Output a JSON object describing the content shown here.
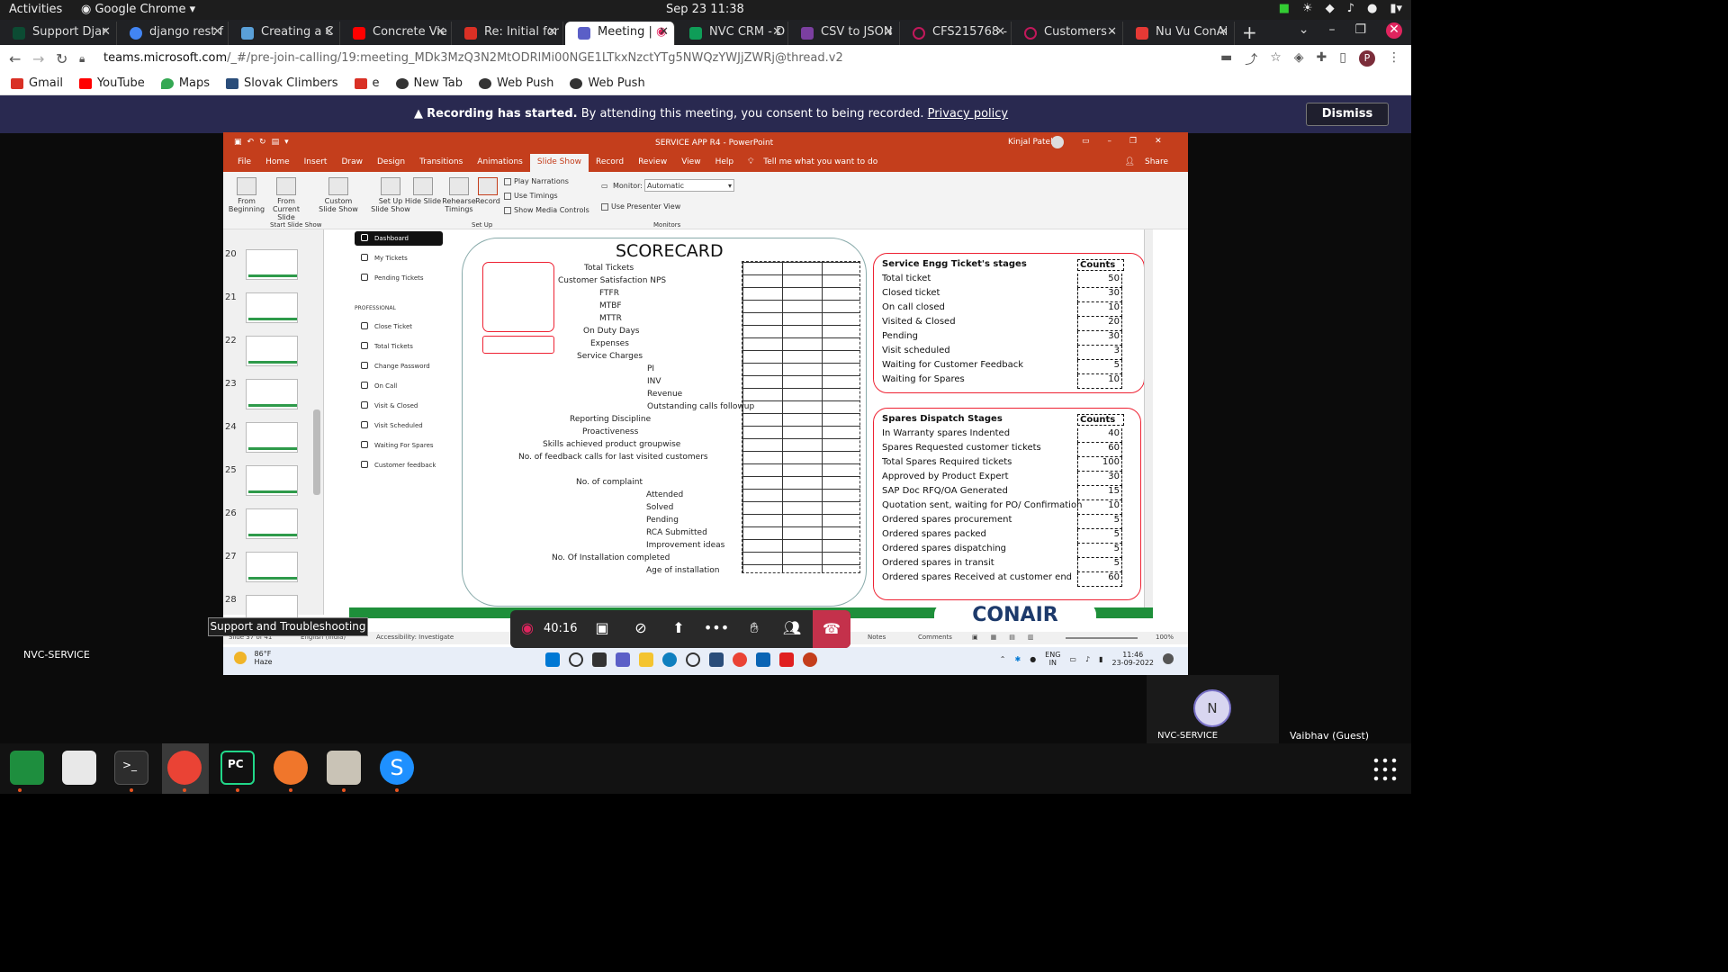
{
  "gnome": {
    "activities": "Activities",
    "app": "Google Chrome",
    "clock": "Sep 23  11:38"
  },
  "tabs": [
    {
      "label": "Support Djar",
      "color": "#0c4b33"
    },
    {
      "label": "django rest f",
      "color": "#4285f4"
    },
    {
      "label": "Creating a C",
      "color": "#5aa0d8"
    },
    {
      "label": "Concrete Vie",
      "color": "#ff0000"
    },
    {
      "label": "Re: Initial for",
      "color": "#d93025"
    },
    {
      "label": "Meeting |",
      "color": "#5b5fc7"
    },
    {
      "label": "NVC CRM - D",
      "color": "#0f9d58"
    },
    {
      "label": "CSV to JSON",
      "color": "#7b3fa0"
    },
    {
      "label": "CFS215768 -",
      "color": "#c2185b"
    },
    {
      "label": "Customers -",
      "color": "#c2185b"
    },
    {
      "label": "Nu Vu ConAi",
      "color": "#e53935"
    }
  ],
  "address": {
    "host": "teams.microsoft.com",
    "path": "/_#/pre-join-calling/19:meeting_MDk3MzQ3N2MtODRlMi00NGE1LTkxNzctYTg5NWQzYWJjZWRj@thread.v2"
  },
  "bookmarks": [
    "Gmail",
    "YouTube",
    "Maps",
    "Slovak Climbers",
    "e",
    "New Tab",
    "Web Push",
    "Web Push"
  ],
  "recording": {
    "bold": "Recording has started.",
    "text": "By attending this meeting, you consent to being recorded.",
    "link": "Privacy policy",
    "dismiss": "Dismiss"
  },
  "ppt": {
    "title": "SERVICE APP R4  -  PowerPoint",
    "user": "Kinjal Patel",
    "ribbon_tabs": [
      "File",
      "Home",
      "Insert",
      "Draw",
      "Design",
      "Transitions",
      "Animations",
      "Slide Show",
      "Record",
      "Review",
      "View",
      "Help",
      "Tell me what you want to do"
    ],
    "share": "Share",
    "ribbon_buttons": [
      "From Beginning",
      "From Current Slide",
      "Custom Slide Show",
      "Set Up Slide Show",
      "Hide Slide",
      "Rehearse Timings",
      "Record"
    ],
    "checks": [
      "Play Narrations",
      "Use Timings",
      "Show Media Controls"
    ],
    "monitor_label": "Monitor:",
    "monitor_value": "Automatic",
    "presenter": "Use Presenter View",
    "groups": [
      "Start Slide Show",
      "Set Up",
      "Monitors"
    ],
    "slide_numbers": [
      "20",
      "21",
      "22",
      "23",
      "24",
      "25",
      "26",
      "27",
      "28"
    ],
    "status": {
      "slide": "Slide 37 of 41",
      "lang": "English (India)",
      "access": "Accessibility: Investigate",
      "notes": "Notes",
      "comments": "Comments",
      "zoom": "100%"
    }
  },
  "slide": {
    "menu": [
      "Dashboard",
      "My Tickets",
      "Pending Tickets",
      "PROFESSIONAL",
      "Close Ticket",
      "Total Tickets",
      "Change Password",
      "On Call",
      "Visit & Closed",
      "Visit Scheduled",
      "Waiting For Spares",
      "Customer feedback"
    ],
    "scorecard_title": "SCORECARD",
    "score_items": [
      "Total Tickets",
      "Customer Satisfaction NPS",
      "FTFR",
      "MTBF",
      "MTTR",
      "On Duty Days",
      "Expenses",
      "Service Charges",
      "PI",
      "INV",
      "Revenue",
      "Outstanding calls followup",
      "Reporting Discipline",
      "Proactiveness",
      "Skills achieved product groupwise",
      "No. of feedback calls for last visited customers",
      "No. of complaint",
      "Attended",
      "Solved",
      "Pending",
      "RCA Submitted",
      "Improvement ideas",
      "No. Of Installation completed",
      "Age of installation"
    ],
    "service_panel": {
      "title": "Service Engg Ticket's stages",
      "counts": "Counts",
      "rows": [
        {
          "label": "Total ticket",
          "value": "50"
        },
        {
          "label": "Closed ticket",
          "value": "30"
        },
        {
          "label": "On call closed",
          "value": "10"
        },
        {
          "label": "Visited & Closed",
          "value": "20"
        },
        {
          "label": "Pending",
          "value": "30"
        },
        {
          "label": "Visit scheduled",
          "value": "3"
        },
        {
          "label": "Waiting for Customer Feedback",
          "value": "5"
        },
        {
          "label": "Waiting for Spares",
          "value": "10"
        }
      ]
    },
    "spares_panel": {
      "title": "Spares Dispatch Stages",
      "counts": "Counts",
      "rows": [
        {
          "label": "In Warranty spares Indented",
          "value": "40"
        },
        {
          "label": "Spares Requested customer tickets",
          "value": "60"
        },
        {
          "label": "Total Spares Required tickets",
          "value": "100"
        },
        {
          "label": "Approved by Product Expert",
          "value": "30"
        },
        {
          "label": "SAP Doc RFQ/OA Generated",
          "value": "15"
        },
        {
          "label": "Quotation sent, waiting for PO/ Confirmation",
          "value": "10"
        },
        {
          "label": "Ordered spares procurement",
          "value": "5"
        },
        {
          "label": "Ordered spares packed",
          "value": "5"
        },
        {
          "label": "Ordered spares dispatching",
          "value": "5"
        },
        {
          "label": "Ordered spares in transit",
          "value": "5"
        },
        {
          "label": "Ordered spares Received at customer end",
          "value": "60"
        }
      ]
    },
    "logo": "CONAIR"
  },
  "win": {
    "temp": "86°F",
    "weather": "Haze",
    "lang": "ENG\nIN",
    "time": "11:46",
    "date": "23-09-2022"
  },
  "meeting": {
    "timer": "40:16",
    "tooltip": "Support and Troubleshooting",
    "self_name": "NVC-SERVICE",
    "participant_initial": "N",
    "participant_name": "NVC-SERVICE",
    "guest": "Vaibhav (Guest)"
  }
}
